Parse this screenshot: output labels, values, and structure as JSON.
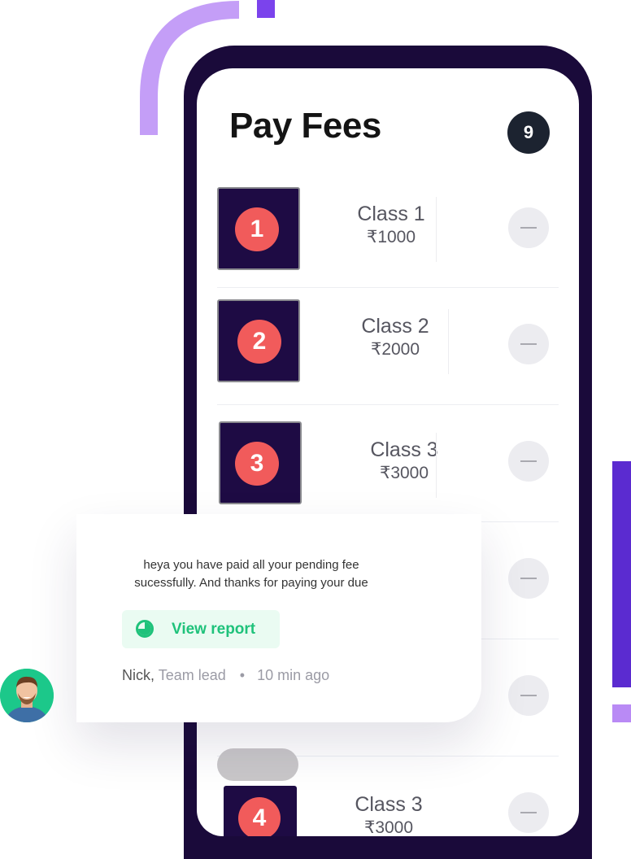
{
  "header": {
    "title": "Pay Fees",
    "count": "9"
  },
  "fees": [
    {
      "number": "1",
      "class": "Class 1",
      "amount": "₹1000"
    },
    {
      "number": "2",
      "class": "Class 2",
      "amount": "₹2000"
    },
    {
      "number": "3",
      "class": "Class 3",
      "amount": "₹3000"
    },
    {
      "number": "4",
      "class": "Class 3",
      "amount": "₹3000"
    }
  ],
  "notification": {
    "message": "heya you have paid all your pending fee sucessfully. And thanks for paying your due",
    "button_label": "View report",
    "author": "Nick,",
    "role": "Team lead",
    "separator": "•",
    "time": "10 min ago"
  },
  "colors": {
    "phone_frame": "#1a0a3a",
    "number_badge": "#f15b5b",
    "report_green": "#1fc27b",
    "accent_purple": "#7b43ec"
  },
  "icons": {
    "report": "pie-chart-icon",
    "remove": "minus-icon"
  }
}
